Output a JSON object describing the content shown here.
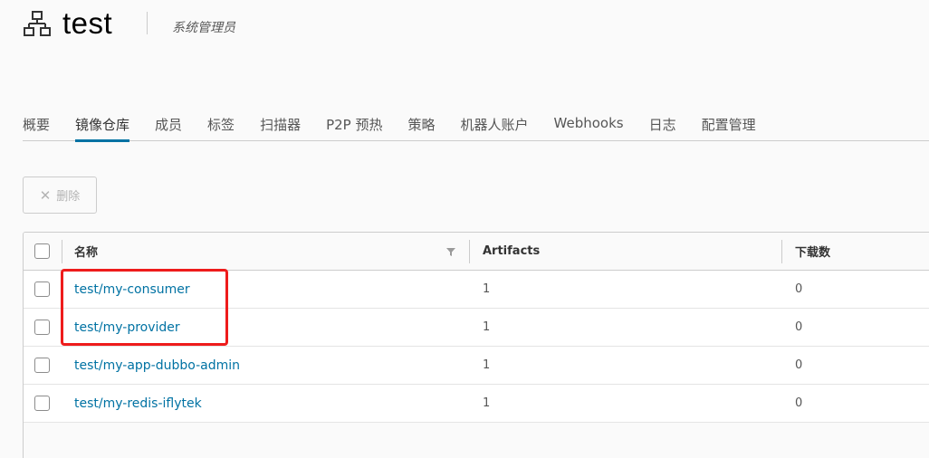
{
  "project": {
    "icon": "project-icon",
    "title": "test",
    "role": "系统管理员"
  },
  "tabs": [
    {
      "label": "概要",
      "active": false
    },
    {
      "label": "镜像仓库",
      "active": true
    },
    {
      "label": "成员",
      "active": false
    },
    {
      "label": "标签",
      "active": false
    },
    {
      "label": "扫描器",
      "active": false
    },
    {
      "label": "P2P 预热",
      "active": false
    },
    {
      "label": "策略",
      "active": false
    },
    {
      "label": "机器人账户",
      "active": false
    },
    {
      "label": "Webhooks",
      "active": false
    },
    {
      "label": "日志",
      "active": false
    },
    {
      "label": "配置管理",
      "active": false
    }
  ],
  "toolbar": {
    "delete_label": "删除",
    "delete_icon": "close-icon"
  },
  "table": {
    "columns": {
      "name": "名称",
      "artifacts": "Artifacts",
      "downloads": "下载数"
    },
    "rows": [
      {
        "name": "test/my-consumer",
        "artifacts": "1",
        "downloads": "0"
      },
      {
        "name": "test/my-provider",
        "artifacts": "1",
        "downloads": "0"
      },
      {
        "name": "test/my-app-dubbo-admin",
        "artifacts": "1",
        "downloads": "0"
      },
      {
        "name": "test/my-redis-iflytek",
        "artifacts": "1",
        "downloads": "0"
      }
    ]
  },
  "colors": {
    "accent": "#0072a3",
    "highlight": "#ee1c1c"
  }
}
